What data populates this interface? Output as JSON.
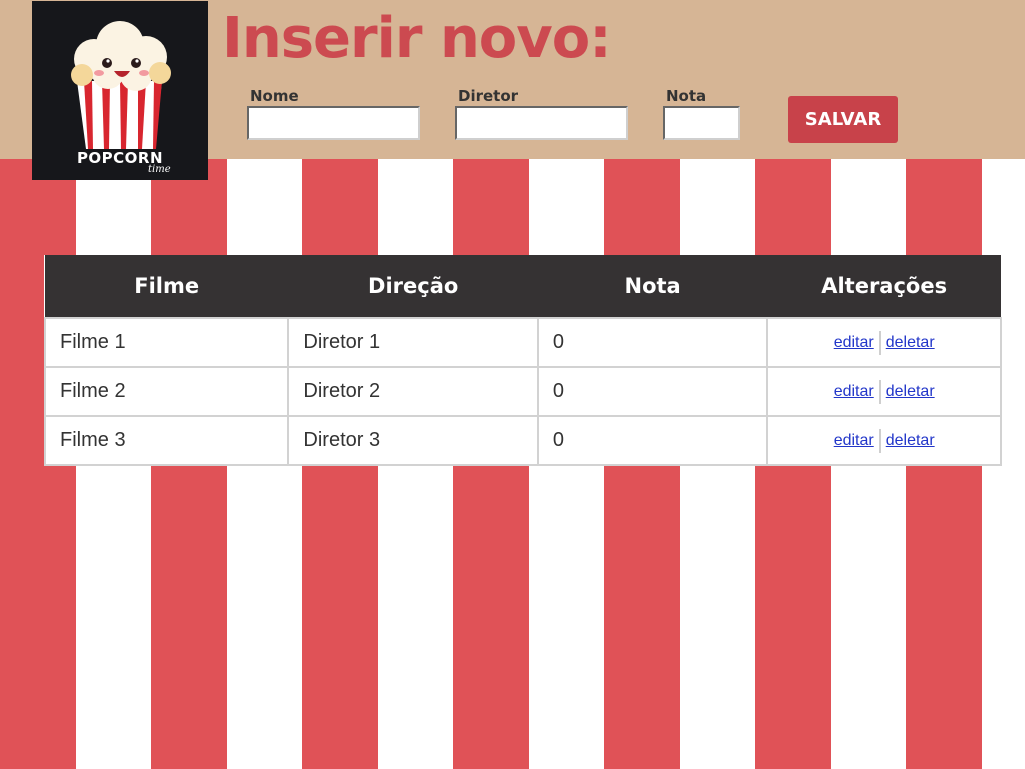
{
  "logo": {
    "word": "POPCORN",
    "sub": "time"
  },
  "form": {
    "title": "Inserir novo:",
    "fields": {
      "nome": {
        "label": "Nome",
        "value": ""
      },
      "diretor": {
        "label": "Diretor",
        "value": ""
      },
      "nota": {
        "label": "Nota",
        "value": ""
      }
    },
    "save_label": "SALVAR"
  },
  "table": {
    "headers": [
      "Filme",
      "Direção",
      "Nota",
      "Alterações"
    ],
    "rows": [
      {
        "filme": "Filme 1",
        "diretor": "Diretor 1",
        "nota": "0"
      },
      {
        "filme": "Filme 2",
        "diretor": "Diretor 2",
        "nota": "0"
      },
      {
        "filme": "Filme 3",
        "diretor": "Diretor 3",
        "nota": "0"
      }
    ],
    "edit_label": "editar",
    "delete_label": "deletar"
  },
  "colors": {
    "stripe_red": "#e05257",
    "header_bg": "#d6b595",
    "accent": "#cc4a50",
    "table_header": "#353233",
    "link": "#2236c9"
  }
}
